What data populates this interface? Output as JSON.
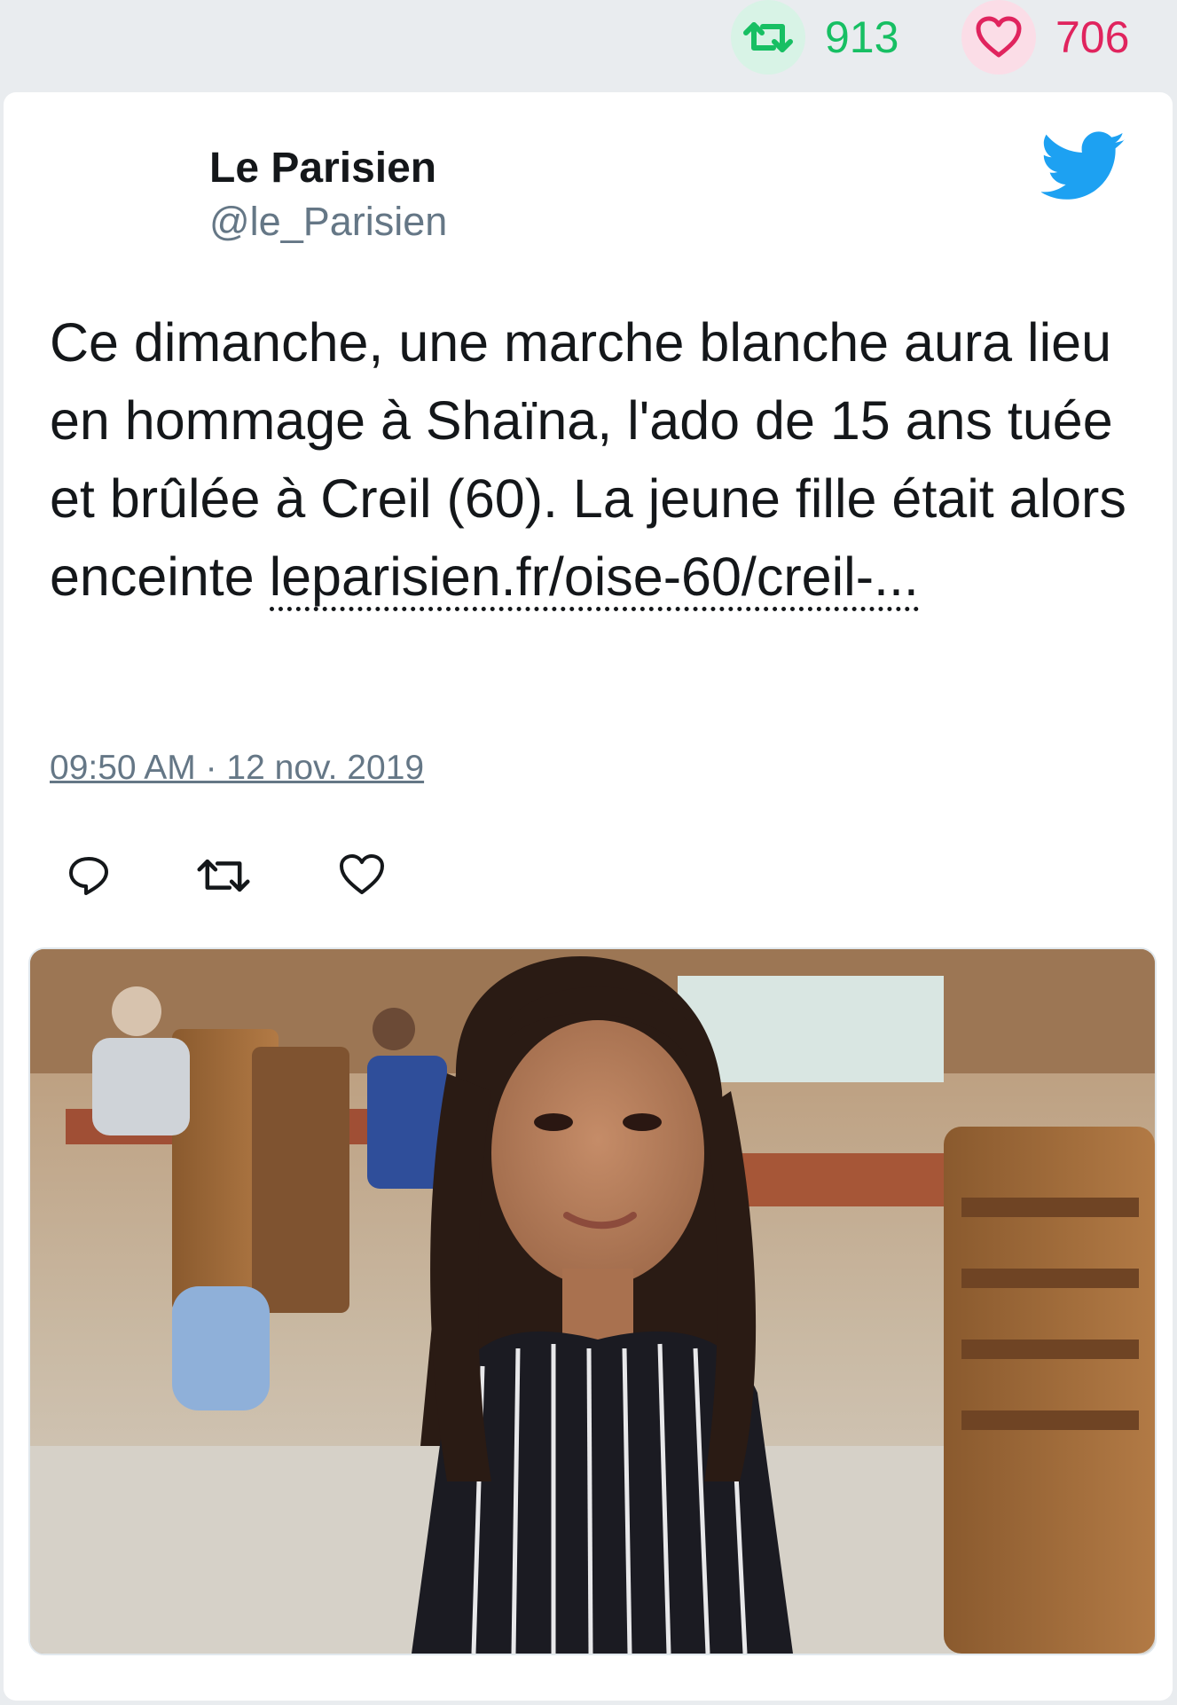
{
  "stats": {
    "retweets": "913",
    "likes": "706"
  },
  "author": {
    "name": "Le Parisien",
    "handle": "@le_Parisien"
  },
  "tweet": {
    "text": "Ce dimanche, une marche blanche aura lieu en hommage à Shaïna, l'ado de 15 ans tuée et brûlée à Creil (60). La jeune fille était alors enceinte ",
    "link": "leparisien.fr/oise-60/creil-...",
    "timestamp": "09:50 AM · 12 nov. 2019"
  },
  "colors": {
    "retweet_green": "#17bf63",
    "like_red": "#e0245e",
    "twitter_blue": "#1da1f2",
    "secondary_text": "#657786"
  },
  "icons": {
    "retweet": "retweet-icon",
    "like": "heart-icon",
    "reply": "reply-icon",
    "brand": "twitter-bird-icon"
  }
}
